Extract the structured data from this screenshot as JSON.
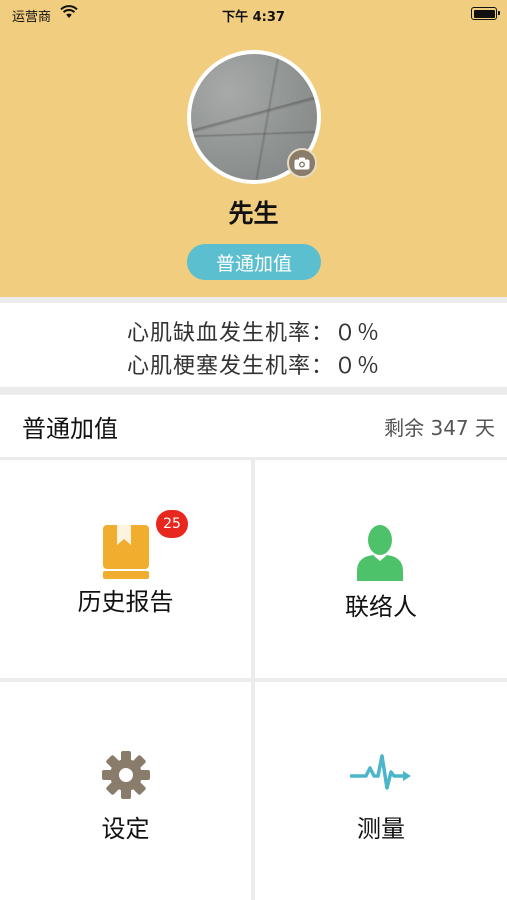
{
  "status_bar": {
    "carrier": "运营商",
    "time": "下午 4:37"
  },
  "profile": {
    "name": "先生",
    "membership_label": "普通加值"
  },
  "stats": {
    "ischemia": "心肌缺血发生机率：０％",
    "infarction": "心肌梗塞发生机率：０％"
  },
  "plan": {
    "title": "普通加值",
    "remaining": "剩余 347 天"
  },
  "tiles": [
    {
      "label": "历史报告",
      "icon": "report-book-icon",
      "badge": "25"
    },
    {
      "label": "联络人",
      "icon": "contact-person-icon"
    },
    {
      "label": "设定",
      "icon": "gear-icon"
    },
    {
      "label": "测量",
      "icon": "heartbeat-icon"
    }
  ],
  "colors": {
    "header_bg": "#f0cd7f",
    "pill_bg": "#5bbfcf",
    "badge_bg": "#e8281e",
    "report_icon": "#f0ad2e",
    "contact_icon": "#4ec26a",
    "gear_icon": "#8a7c6a",
    "pulse_icon": "#4bb5c9"
  }
}
